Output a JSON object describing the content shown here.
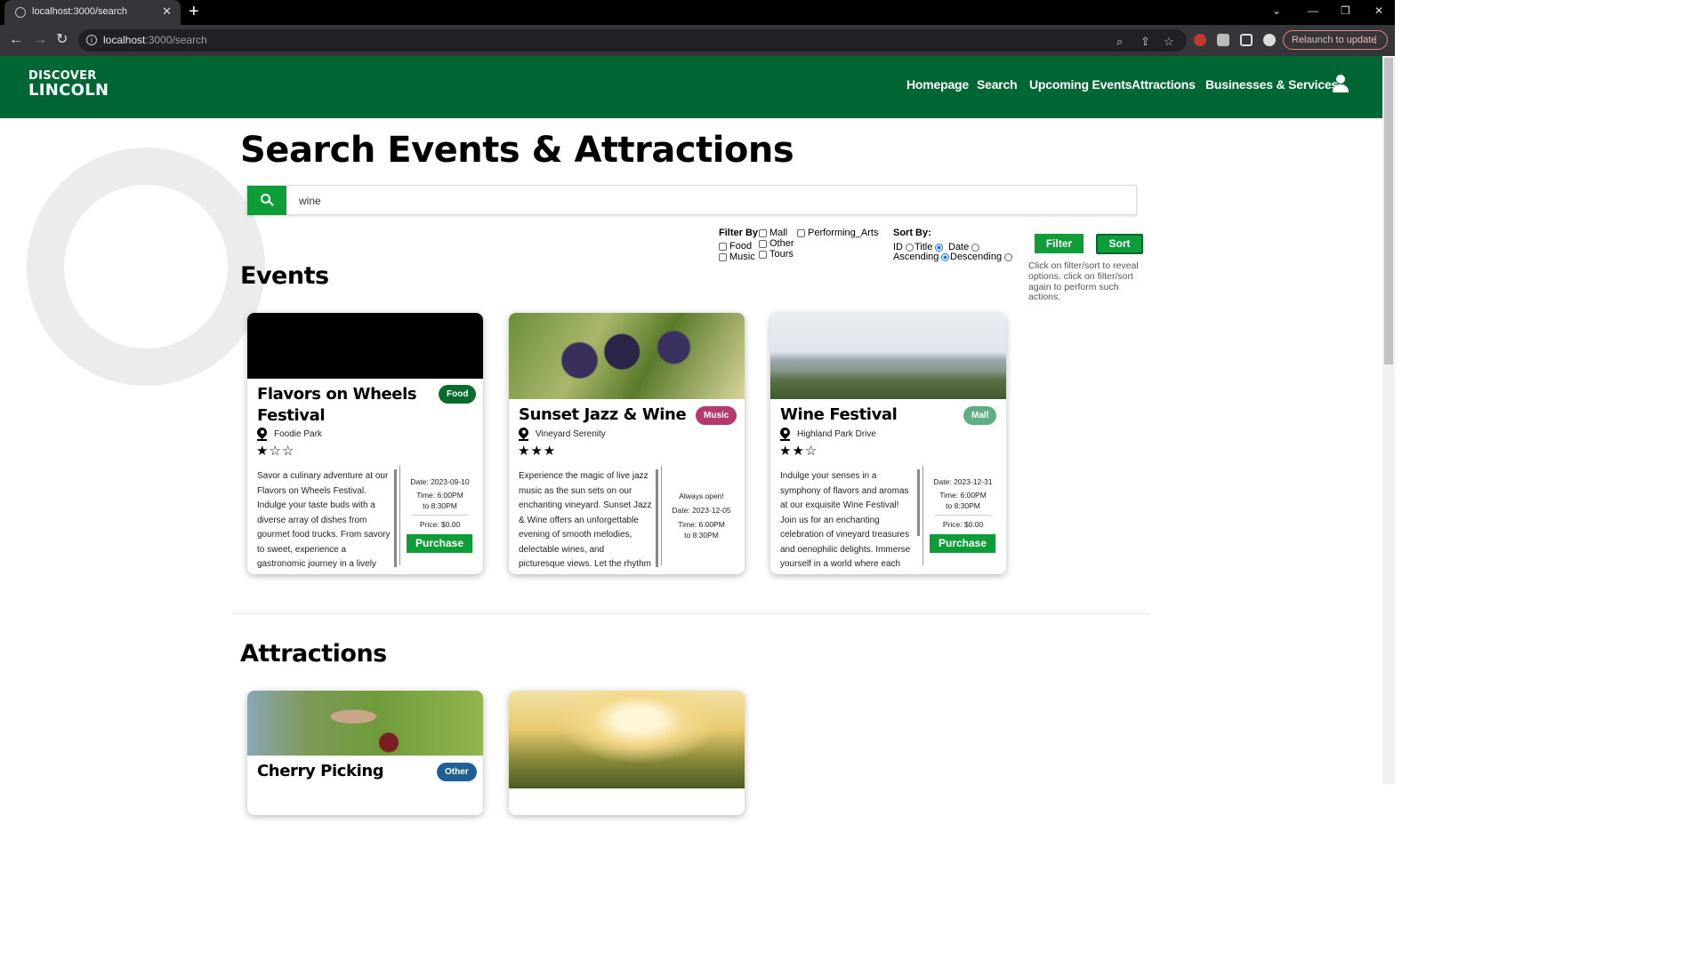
{
  "browser": {
    "tab_title": "localhost:3000/search",
    "url_host": "localhost",
    "url_rest": ":3000/search",
    "relaunch_label": "Relaunch to update"
  },
  "site": {
    "logo_line1": "DISCOVER",
    "logo_line2": "LINCOLN",
    "nav": [
      "Homepage",
      "Search",
      "Upcoming Events",
      "Attractions",
      "Businesses & Services"
    ]
  },
  "page": {
    "title": "Search Events & Attractions",
    "search_value": "wine"
  },
  "filter": {
    "label": "Filter By:",
    "options": [
      "Mall",
      "Performing_Arts",
      "Food",
      "Other",
      "Music",
      "Tours"
    ]
  },
  "sort": {
    "label": "Sort By:",
    "fields": [
      "ID",
      "Title",
      "Date"
    ],
    "selected_field": "Date",
    "orders": [
      "Ascending",
      "Descending"
    ],
    "selected_order": "Ascending",
    "filter_button": "Filter",
    "sort_button": "Sort",
    "hint": "Click on filter/sort to reveal options. click on filter/sort again to perform such actions."
  },
  "events_title": "Events",
  "events": [
    {
      "title_line1": "Flavors on Wheels",
      "title_line2": "Festival",
      "badge": "Food",
      "badge_color": "#0a6b2c",
      "location": "Foodie Park",
      "rating": 1,
      "description": "Savor a culinary adventure at our Flavors on Wheels Festival. Indulge your taste buds with a diverse array of dishes from gourmet food trucks. From savory to sweet, experience a gastronomic journey in a lively outdoor setting. Bring your appetite",
      "date": "Date: 2023-09-10",
      "time": "Time: 6:00PM to 8:30PM",
      "price": "Price: $0.00",
      "purchase": "Purchase"
    },
    {
      "title_line1": "Sunset Jazz & Wine",
      "badge": "Music",
      "badge_color": "#b5386f",
      "location": "Vineyard Serenity",
      "rating": 3,
      "description": "Experience the magic of live jazz music as the sun sets on our enchanting vineyard. Sunset Jazz & Wine offers an unforgettable evening of smooth melodies, delectable wines, and picturesque views. Let the rhythm of jazz serenade you under",
      "always_open": "Always open!",
      "date": "Date: 2023-12-05",
      "time": "Time: 6:00PM to 8:30PM"
    },
    {
      "title_line1": "Wine Festival",
      "badge": "Mall",
      "badge_color": "#5fae85",
      "location": "Highland Park Drive",
      "rating": 2,
      "description": "Indulge your senses in a symphony of flavors and aromas at our exquisite Wine Festival! Join us for an enchanting celebration of vineyard treasures and oenophilic delights. Immerse yourself in a world where each sip tells a story, where the",
      "date": "Date: 2023-12-31",
      "time": "Time: 6:00PM to 8:30PM",
      "price": "Price: $0.00",
      "purchase": "Purchase"
    }
  ],
  "attractions_title": "Attractions",
  "attractions": [
    {
      "title": "Cherry Picking",
      "badge": "Other",
      "badge_color": "#1f5f96"
    },
    {
      "title": ""
    }
  ]
}
